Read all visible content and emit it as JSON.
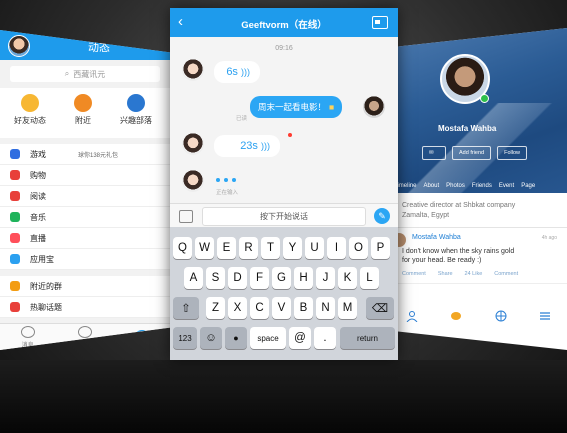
{
  "left_app": {
    "header_title": "动态",
    "search_placeholder": "西藏讯元",
    "quick": [
      {
        "label": "好友动态",
        "icon": "star-icon",
        "color": "#f7b733"
      },
      {
        "label": "附近",
        "icon": "location-pin-icon",
        "color": "#f08a24"
      },
      {
        "label": "兴趣部落",
        "icon": "tribe-icon",
        "color": "#2a77d0"
      }
    ],
    "list": [
      {
        "label": "游戏",
        "sub": "球你138元礼包",
        "color": "#2f6de0"
      },
      {
        "label": "购物",
        "sub": "",
        "color": "#e8403a"
      },
      {
        "label": "阅读",
        "sub": "",
        "color": "#e8403a"
      },
      {
        "label": "音乐",
        "sub": "",
        "color": "#1fb35b"
      },
      {
        "label": "直播",
        "sub": "",
        "color": "#ff4f5a"
      },
      {
        "label": "应用宝",
        "sub": "",
        "color": "#2ba0f0"
      },
      {
        "label": "附近的群",
        "sub": "",
        "color": "#f39c12"
      },
      {
        "label": "热聊话题",
        "sub": "",
        "color": "#e8403a"
      }
    ],
    "tabbar": [
      "消息",
      "联系人"
    ]
  },
  "chat": {
    "title": "Geeftvorm（在线）",
    "time": "09:16",
    "voice1": "6s",
    "sent_text": "周末一起看电影！",
    "sent_status": "已读",
    "voice2": "23s",
    "typing_label": "正在输入",
    "input_placeholder": "按下开始说话"
  },
  "keyboard": {
    "row1": [
      "Q",
      "W",
      "E",
      "R",
      "T",
      "Y",
      "U",
      "I",
      "O",
      "P"
    ],
    "row2": [
      "A",
      "S",
      "D",
      "F",
      "G",
      "H",
      "J",
      "K",
      "L"
    ],
    "row3": [
      "Z",
      "X",
      "C",
      "V",
      "B",
      "N",
      "M"
    ],
    "num_key": "123",
    "space_key": "space",
    "at_key": "@",
    "dot_key": ".",
    "return_key": "return"
  },
  "profile": {
    "name": "Mostafa Wahba",
    "add_friend": "Add friend",
    "follow": "Follow",
    "tabs": [
      "Timeline",
      "About",
      "Photos",
      "Friends",
      "Event",
      "Page"
    ],
    "bio": "Creative director at Shbkat company\nZamalta, Egypt",
    "post": {
      "author": "Mostafa Wahba",
      "time": "4h ago",
      "text": "I don't know when the sky rains gold\nfor your head. Be ready :)",
      "actions": [
        "Comment",
        "Share",
        "24 Like",
        "Comment"
      ]
    }
  }
}
